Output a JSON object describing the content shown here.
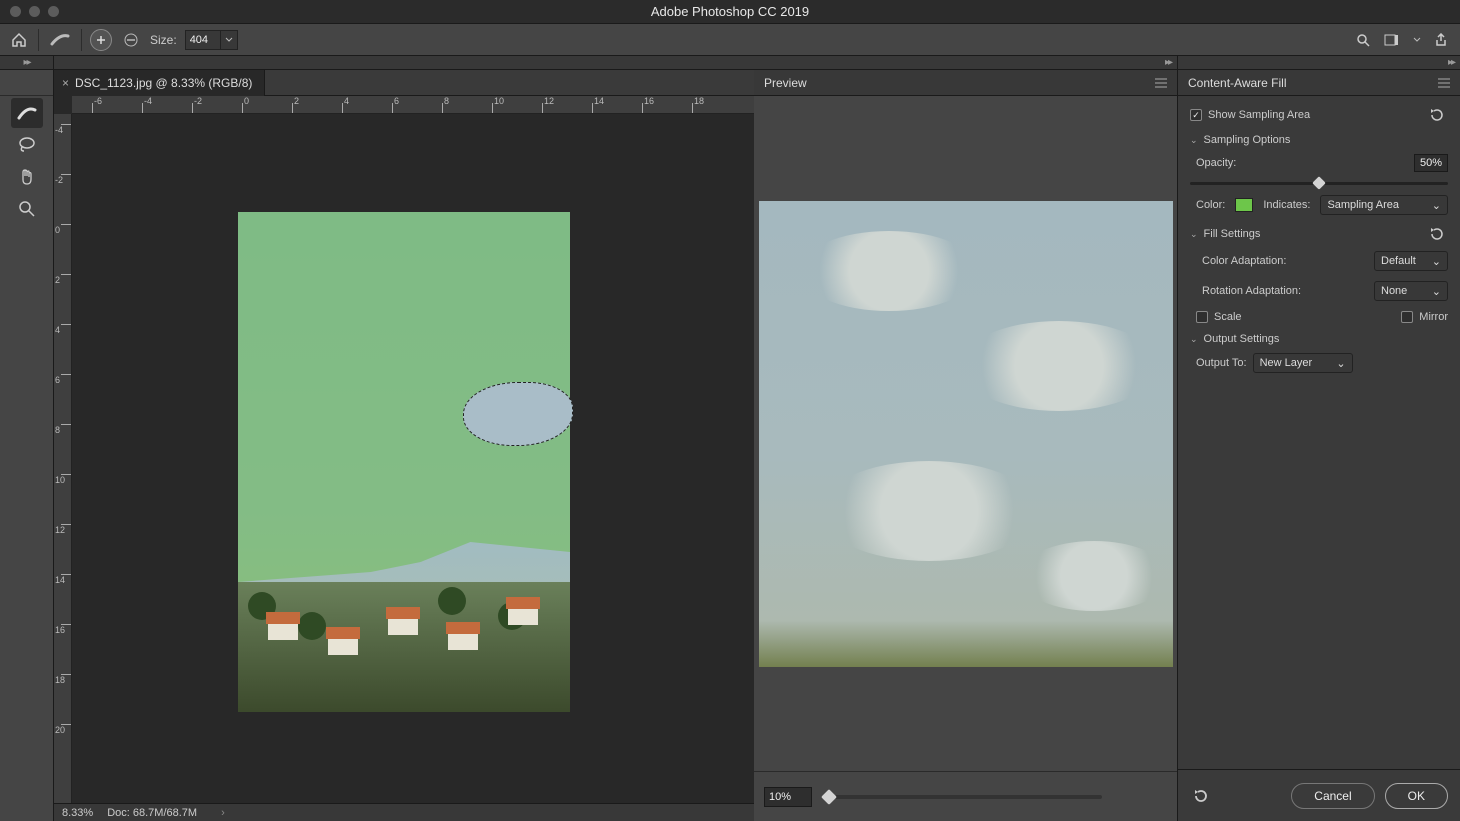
{
  "titlebar": {
    "app_title": "Adobe Photoshop CC 2019"
  },
  "optionbar": {
    "size_label": "Size:",
    "size_value": "404"
  },
  "document": {
    "tab_title": "DSC_1123.jpg @ 8.33% (RGB/8)",
    "zoom_status": "8.33%",
    "doc_size_status": "Doc: 68.7M/68.7M",
    "ruler_h": [
      "-6",
      "-4",
      "-2",
      "0",
      "2",
      "4",
      "6",
      "8",
      "10",
      "12",
      "14",
      "16",
      "18"
    ],
    "ruler_v": [
      "-4",
      "-2",
      "0",
      "2",
      "4",
      "6",
      "8",
      "10",
      "12",
      "14",
      "16",
      "18",
      "20"
    ]
  },
  "preview": {
    "panel_title": "Preview",
    "zoom_value": "10%"
  },
  "caf": {
    "panel_title": "Content-Aware Fill",
    "show_sampling_label": "Show Sampling Area",
    "show_sampling_checked": true,
    "sampling_section": "Sampling Options",
    "opacity_label": "Opacity:",
    "opacity_value": "50%",
    "color_label": "Color:",
    "indicates_label": "Indicates:",
    "indicates_value": "Sampling Area",
    "fill_section": "Fill Settings",
    "color_adapt_label": "Color Adaptation:",
    "color_adapt_value": "Default",
    "rotation_adapt_label": "Rotation Adaptation:",
    "rotation_adapt_value": "None",
    "scale_label": "Scale",
    "mirror_label": "Mirror",
    "output_section": "Output Settings",
    "output_to_label": "Output To:",
    "output_to_value": "New Layer",
    "cancel_label": "Cancel",
    "ok_label": "OK"
  },
  "colors": {
    "sampling_overlay": "#6dc64a"
  }
}
